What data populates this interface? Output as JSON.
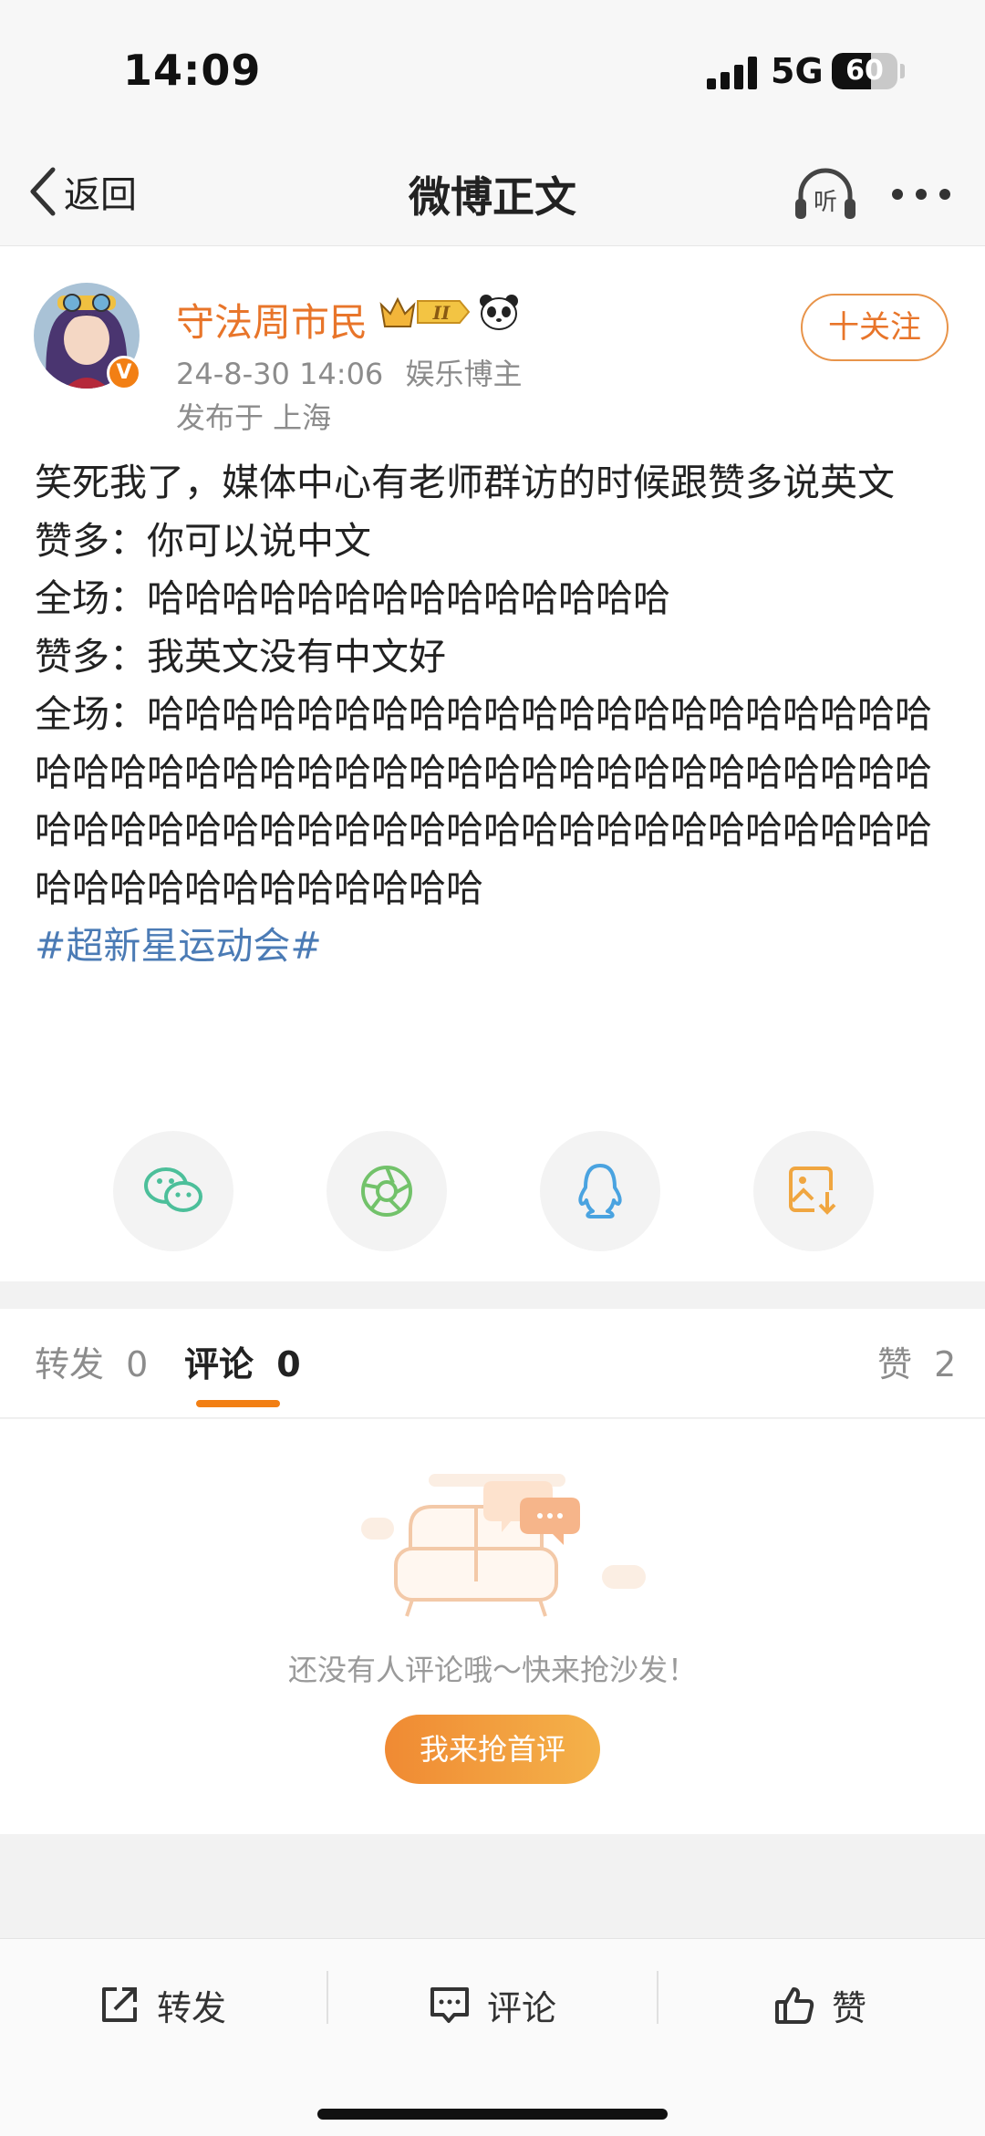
{
  "status_bar": {
    "time": "14:09",
    "network": "5G",
    "battery": "60",
    "battery_level": 0.6
  },
  "nav": {
    "back_label": "返回",
    "title": "微博正文",
    "listen_label": "听"
  },
  "post": {
    "username": "守法周市民",
    "verified_mark": "V",
    "timestamp": "24-8-30 14:06",
    "source": "娱乐博主",
    "location": "发布于 上海",
    "follow_label": "十关注",
    "lines": [
      "笑死我了，媒体中心有老师群访的时候跟赞多说英文",
      "赞多：你可以说中文",
      "全场：哈哈哈哈哈哈哈哈哈哈哈哈哈哈",
      "赞多：我英文没有中文好",
      "全场：哈哈哈哈哈哈哈哈哈哈哈哈哈哈哈哈哈哈哈哈哈哈哈哈哈哈哈哈哈哈哈哈哈哈哈哈哈哈哈哈哈哈哈哈哈哈哈哈哈哈哈哈哈哈哈哈哈哈哈哈哈哈哈哈哈哈哈哈哈哈哈哈哈哈哈哈哈哈哈哈哈"
    ],
    "topic": "#超新星运动会#",
    "share_icons": [
      "wechat-icon",
      "moments-icon",
      "qq-icon",
      "save-image-icon"
    ]
  },
  "tabs": [
    {
      "label": "转发",
      "count": "0"
    },
    {
      "label": "评论",
      "count": "0"
    },
    {
      "label": "赞",
      "count": "2"
    }
  ],
  "empty_state": {
    "message": "还没有人评论哦～快来抢沙发！",
    "button_label": "我来抢首评"
  },
  "bottom_bar": {
    "repost_label": "转发",
    "comment_label": "评论",
    "like_label": "赞"
  },
  "colors": {
    "accent": "#f27f14",
    "username": "#e8752a",
    "topic": "#4b7bb5"
  }
}
